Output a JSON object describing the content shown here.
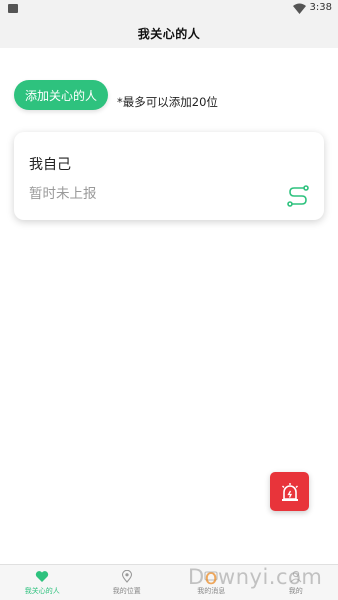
{
  "status_bar": {
    "time": "3:38"
  },
  "header": {
    "title": "我关心的人"
  },
  "actions": {
    "add_button_label": "添加关心的人",
    "limit_hint": "*最多可以添加20位"
  },
  "contacts": [
    {
      "name": "我自己",
      "status": "暂时未上报"
    }
  ],
  "bottom_nav": {
    "items": [
      {
        "label": "我关心的人",
        "icon": "heart-icon",
        "active": true
      },
      {
        "label": "我的位置",
        "icon": "location-pin-icon",
        "active": false
      },
      {
        "label": "我的消息",
        "icon": "message-icon",
        "active": false
      },
      {
        "label": "我的",
        "icon": "person-icon",
        "active": false
      }
    ]
  },
  "watermark": {
    "text_left": "D",
    "text_o": "o",
    "text_right": "wnyi.com"
  },
  "colors": {
    "accent": "#2ec27e",
    "alarm": "#e8343a"
  }
}
